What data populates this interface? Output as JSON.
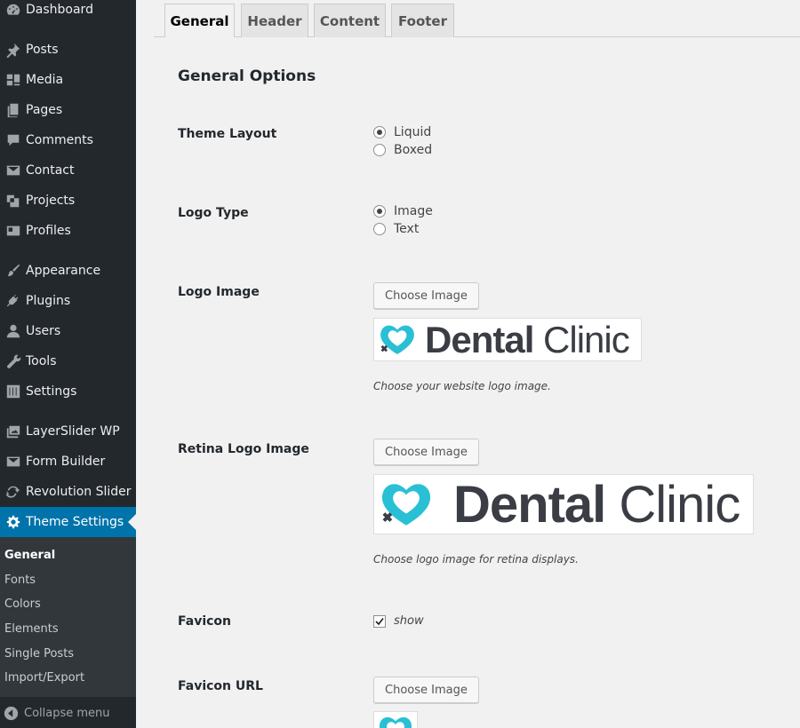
{
  "sidebar": {
    "items": [
      {
        "label": "Dashboard",
        "icon": "dashboard-icon"
      },
      {
        "label": "Posts",
        "icon": "pushpin-icon"
      },
      {
        "label": "Media",
        "icon": "media-icon"
      },
      {
        "label": "Pages",
        "icon": "pages-icon"
      },
      {
        "label": "Comments",
        "icon": "comment-icon"
      },
      {
        "label": "Contact",
        "icon": "envelope-icon"
      },
      {
        "label": "Projects",
        "icon": "projects-icon"
      },
      {
        "label": "Profiles",
        "icon": "id-card-icon"
      },
      {
        "label": "Appearance",
        "icon": "paintbrush-icon"
      },
      {
        "label": "Plugins",
        "icon": "plug-icon"
      },
      {
        "label": "Users",
        "icon": "user-icon"
      },
      {
        "label": "Tools",
        "icon": "wrench-icon"
      },
      {
        "label": "Settings",
        "icon": "sliders-icon"
      },
      {
        "label": "LayerSlider WP",
        "icon": "images-icon"
      },
      {
        "label": "Form Builder",
        "icon": "envelope-icon"
      },
      {
        "label": "Revolution Slider",
        "icon": "refresh-icon"
      },
      {
        "label": "Theme Settings",
        "icon": "gear-icon"
      }
    ],
    "submenu": [
      "General",
      "Fonts",
      "Colors",
      "Elements",
      "Single Posts",
      "Import/Export"
    ],
    "collapse_label": "Collapse menu"
  },
  "tabs": [
    "General",
    "Header",
    "Content",
    "Footer"
  ],
  "section_title": "General Options",
  "fields": {
    "theme_layout": {
      "label": "Theme Layout",
      "options": [
        "Liquid",
        "Boxed"
      ],
      "selected": "Liquid"
    },
    "logo_type": {
      "label": "Logo Type",
      "options": [
        "Image",
        "Text"
      ],
      "selected": "Image"
    },
    "logo_image": {
      "label": "Logo Image",
      "button": "Choose Image",
      "hint": "Choose your website logo image."
    },
    "retina_logo_image": {
      "label": "Retina Logo Image",
      "button": "Choose Image",
      "hint": "Choose logo image for retina displays."
    },
    "favicon": {
      "label": "Favicon",
      "checkbox_label": "show",
      "checked": true
    },
    "favicon_url": {
      "label": "Favicon URL",
      "button": "Choose Image"
    }
  },
  "logo": {
    "word1": "Dental",
    "word2": "Clinic",
    "mark_color": "#29c0d5",
    "text_color": "#3a3d44"
  },
  "colors": {
    "sidebar_bg": "#23282d",
    "accent": "#0073aa",
    "submenu_bg": "#32373c"
  }
}
